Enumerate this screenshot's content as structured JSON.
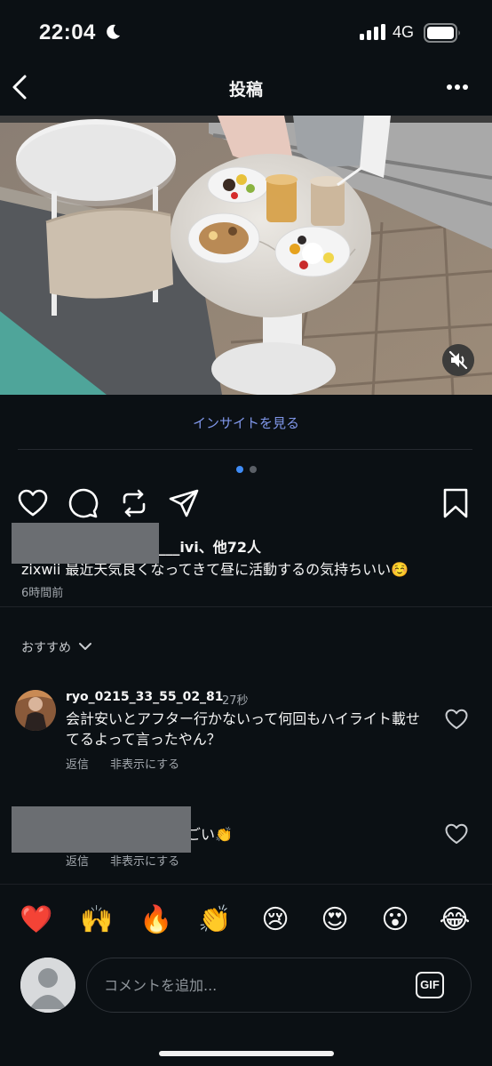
{
  "status_bar": {
    "time": "22:04",
    "network": "4G",
    "moon_icon": "moon-icon",
    "signal_icon": "signal-icon",
    "battery_icon": "battery-icon"
  },
  "header": {
    "title": "投稿",
    "back_icon": "chevron-left-icon",
    "more_icon": "more-icon"
  },
  "post": {
    "insight_link": "インサイトを見る",
    "carousel": {
      "current": 1,
      "total": 2
    },
    "likes_text": "x___ivi、他72人",
    "caption": "zixwii 最近天気良くなってきて昼に活動するの気持ちいい☺️",
    "time_ago": "6時間前"
  },
  "comments_section": {
    "sort_label": "おすすめ",
    "comments": [
      {
        "username": "ryo_0215_33_55_02_81",
        "time": "27秒",
        "text_line1": "会計安いとアフター行かないって何回もハイライト載せ",
        "text_line2": "てるよって言ったやん？",
        "reply": "返信",
        "hide": "非表示にする"
      },
      {
        "text": "ごい👏",
        "reply": "返信",
        "hide": "非表示にする"
      }
    ]
  },
  "emoji_bar": [
    "❤️",
    "🙌",
    "🔥",
    "👏",
    "😢",
    "😍",
    "😮",
    "😂"
  ],
  "comment_input": {
    "placeholder": "コメントを追加...",
    "gif_label": "GIF"
  },
  "colors": {
    "background": "#0b1014",
    "link": "#7f96e8",
    "active_dot": "#3f8cf6"
  }
}
